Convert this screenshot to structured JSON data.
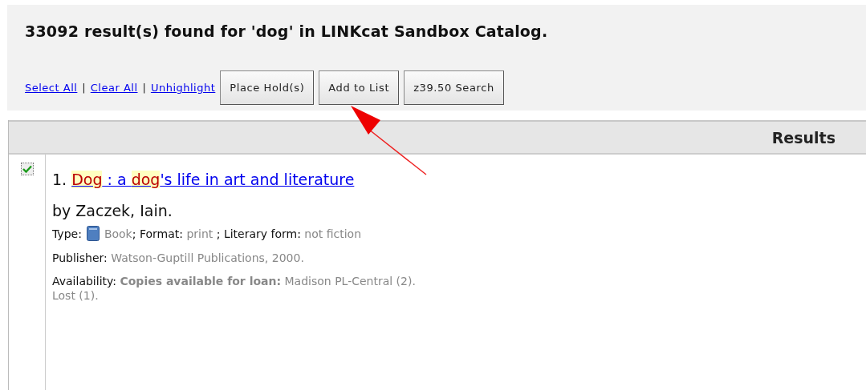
{
  "heading": "33092 result(s) found for 'dog' in LINKcat Sandbox Catalog.",
  "links": [
    "Select All",
    "Clear All",
    "Unhighlight"
  ],
  "separator": "|",
  "buttons": [
    "Place Hold(s)",
    "Add to List",
    "z39.50 Search"
  ],
  "results_header": "Results",
  "results": [
    {
      "checked": true,
      "number": "1.",
      "title_parts": [
        {
          "text": "Dog",
          "highlighted": true
        },
        {
          "text": " : a ",
          "highlighted": false
        },
        {
          "text": "dog",
          "highlighted": true
        },
        {
          "text": "'s life in art and literature",
          "highlighted": false
        }
      ],
      "author": "by Zaczek, Iain.",
      "type_label": "Type:",
      "type_rest": [
        {
          "text": "Book",
          "kind": "value"
        },
        {
          "text": "; Format: ",
          "kind": "label"
        },
        {
          "text": "print ",
          "kind": "value"
        },
        {
          "text": "; Literary form: ",
          "kind": "label"
        },
        {
          "text": "not fiction",
          "kind": "value"
        }
      ],
      "publisher": [
        {
          "text": "Publisher: ",
          "kind": "label"
        },
        {
          "text": "Watson-Guptill Publications, 2000.",
          "kind": "value"
        }
      ],
      "availability": [
        {
          "text": "Availability: ",
          "kind": "label"
        },
        {
          "text": "Copies available for loan:",
          "kind": "strong"
        },
        {
          "text": " Madison PL-Central (2).",
          "kind": "value"
        }
      ],
      "availability_more": "Lost (1)."
    }
  ],
  "annotation": {
    "kind": "arrow"
  }
}
